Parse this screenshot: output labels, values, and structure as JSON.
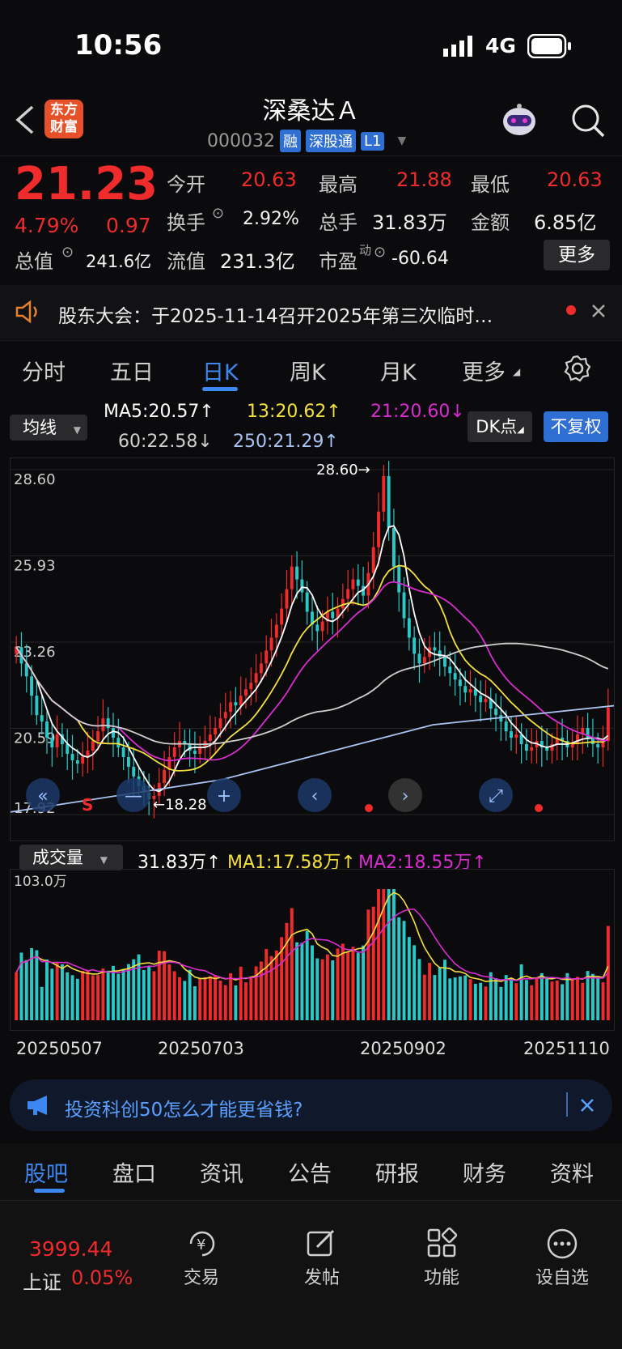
{
  "status": {
    "time": "10:56",
    "network": "4G"
  },
  "header": {
    "logo_line1": "东方",
    "logo_line2": "财富",
    "title": "深桑达Ａ",
    "code": "000032",
    "tags": [
      "融",
      "深股通",
      "L1"
    ]
  },
  "quote": {
    "price": "21.23",
    "change_pct": "4.79%",
    "change": "0.97",
    "open_label": "今开",
    "open": "20.63",
    "high_label": "最高",
    "high": "21.88",
    "low_label": "最低",
    "low": "20.63",
    "turnover_label": "换手",
    "turnover": "2.92%",
    "volume_label": "总手",
    "volume": "31.83万",
    "amount_label": "金额",
    "amount": "6.85亿",
    "mktcap_label": "总值",
    "mktcap": "241.6亿",
    "float_label": "流值",
    "float_cap": "231.3亿",
    "pe_label": "市盈",
    "pe_sup": "动",
    "pe": "-60.64",
    "more": "更多"
  },
  "notice": {
    "text": "股东大会：于2025-11-14召开2025年第三次临时…"
  },
  "period_tabs": [
    "分时",
    "五日",
    "日K",
    "周K",
    "月K",
    "更多"
  ],
  "active_period": 2,
  "ma": {
    "selector": "均线",
    "ma5": "MA5:20.57↑",
    "ma13": "13:20.62↑",
    "ma21": "21:20.60↓",
    "ma60": "60:22.58↓",
    "ma250": "250:21.29↑",
    "dk": "DK点",
    "adjust": "不复权"
  },
  "colors": {
    "up": "#ef2b2b",
    "down": "#2bc8c8",
    "ma5": "#ffffff",
    "ma13": "#f5e03c",
    "ma21": "#d92cd0",
    "ma60": "#cfcfcf",
    "ma250": "#a9c4f2",
    "accent": "#3d88f0"
  },
  "chart_data": {
    "type": "candlestick",
    "y_axis_labels": [
      "28.60",
      "25.93",
      "23.26",
      "20.59",
      "17.92"
    ],
    "ylim": [
      17.92,
      28.6
    ],
    "max_annotation": "28.60→",
    "min_annotation": "←18.28",
    "signal_label": "S",
    "x_labels": [
      "20250507",
      "20250703",
      "20250902",
      "20251110"
    ],
    "closes": [
      23.1,
      22.6,
      22.2,
      21.6,
      21.0,
      20.8,
      20.3,
      20.0,
      20.4,
      20.1,
      19.8,
      19.6,
      19.5,
      19.7,
      19.9,
      20.2,
      20.5,
      20.9,
      20.6,
      20.3,
      20.0,
      19.7,
      19.4,
      19.1,
      18.8,
      18.6,
      18.4,
      18.5,
      18.9,
      19.3,
      19.7,
      20.0,
      20.2,
      20.1,
      19.9,
      19.8,
      20.0,
      20.2,
      20.4,
      20.6,
      20.9,
      21.1,
      21.4,
      21.3,
      21.6,
      21.8,
      22.0,
      22.3,
      22.6,
      23.0,
      23.4,
      23.8,
      24.3,
      24.9,
      25.6,
      25.2,
      24.8,
      24.2,
      23.8,
      23.6,
      23.9,
      24.2,
      24.0,
      24.3,
      24.6,
      24.9,
      25.2,
      25.0,
      24.7,
      25.4,
      26.2,
      27.3,
      28.4,
      26.8,
      25.6,
      24.8,
      24.0,
      23.4,
      22.9,
      22.6,
      22.8,
      23.1,
      23.0,
      22.8,
      22.5,
      22.3,
      22.1,
      21.9,
      21.7,
      21.8,
      21.6,
      21.4,
      21.5,
      21.2,
      21.0,
      20.8,
      20.5,
      20.3,
      20.4,
      20.1,
      19.9,
      20.0,
      20.2,
      20.0,
      19.9,
      20.1,
      20.3,
      20.2,
      20.0,
      20.1,
      20.4,
      20.6,
      20.3,
      20.1,
      20.0,
      20.2,
      21.23
    ],
    "ma_series": [
      {
        "name": "MA5",
        "value": 20.57
      },
      {
        "name": "13",
        "value": 20.62
      },
      {
        "name": "21",
        "value": 20.6
      },
      {
        "name": "60",
        "value": 22.58
      },
      {
        "name": "250",
        "value": 21.29
      }
    ]
  },
  "volume": {
    "selector": "成交量",
    "today": "31.83万↑",
    "ma1": "MA1:17.58万↑",
    "ma2": "MA2:18.55万↑",
    "max_label": "103.0万",
    "ylim": [
      0,
      103.0
    ]
  },
  "ad": {
    "text": "投资科创50怎么才能更省钱?"
  },
  "bottom_tabs": [
    "股吧",
    "盘口",
    "资讯",
    "公告",
    "研报",
    "财务",
    "资料"
  ],
  "footer": {
    "index_value": "3999.44",
    "index_name": "上证",
    "index_change": "0.05%",
    "items": [
      "交易",
      "发帖",
      "功能",
      "设自选"
    ]
  }
}
